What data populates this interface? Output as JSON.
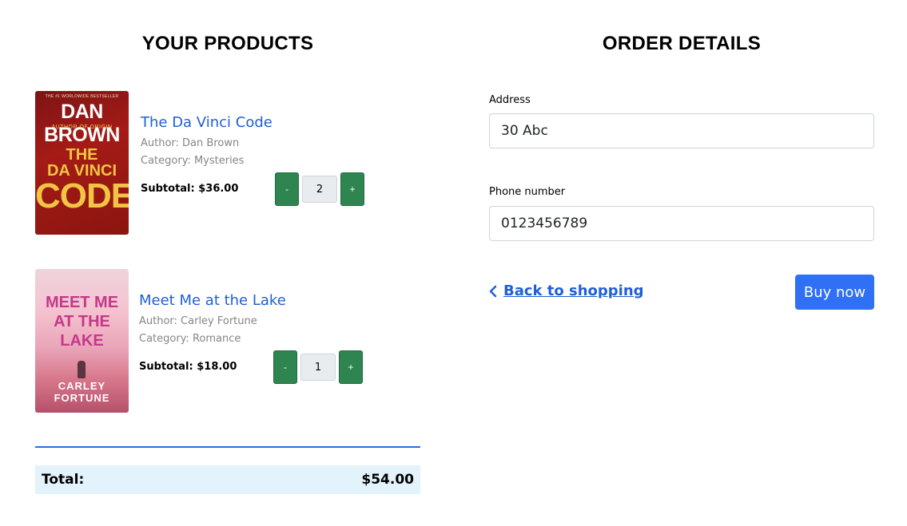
{
  "products_section": {
    "title": "YOUR PRODUCTS",
    "items": [
      {
        "title": "The Da Vinci Code",
        "author": "Author: Dan Brown",
        "category": "Category: Mysteries",
        "subtotal": "Subtotal: $36.00",
        "quantity": "2",
        "decrease_label": "-",
        "increase_label": "+",
        "cover": {
          "top_line": "THE #1 WORLDWIDE BESTSELLER",
          "author_big": "DAN BROWN",
          "subline": "AUTHOR OF ORIGIN",
          "title_l1": "THE",
          "title_l2": "DA VINCI",
          "title_l3": "CODE"
        }
      },
      {
        "title": "Meet Me at the Lake",
        "author": "Author: Carley Fortune",
        "category": "Category: Romance",
        "subtotal": "Subtotal: $18.00",
        "quantity": "1",
        "decrease_label": "-",
        "increase_label": "+",
        "cover": {
          "title_l1": "MEET ME",
          "title_l2": "AT THE",
          "title_l3": "LAKE",
          "author_l1": "CARLEY",
          "author_l2": "FORTUNE"
        }
      }
    ],
    "total_label": "Total:",
    "total_value": "$54.00"
  },
  "order_section": {
    "title": "ORDER DETAILS",
    "address_label": "Address",
    "address_value": "30 Abc",
    "phone_label": "Phone number",
    "phone_value": "0123456789",
    "back_label": "Back to shopping",
    "buy_label": "Buy now"
  },
  "colors": {
    "link_blue": "#1f5fd6",
    "qty_green": "#2e8550",
    "buy_blue": "#2f70f5",
    "total_bg": "#e2f3fb"
  }
}
